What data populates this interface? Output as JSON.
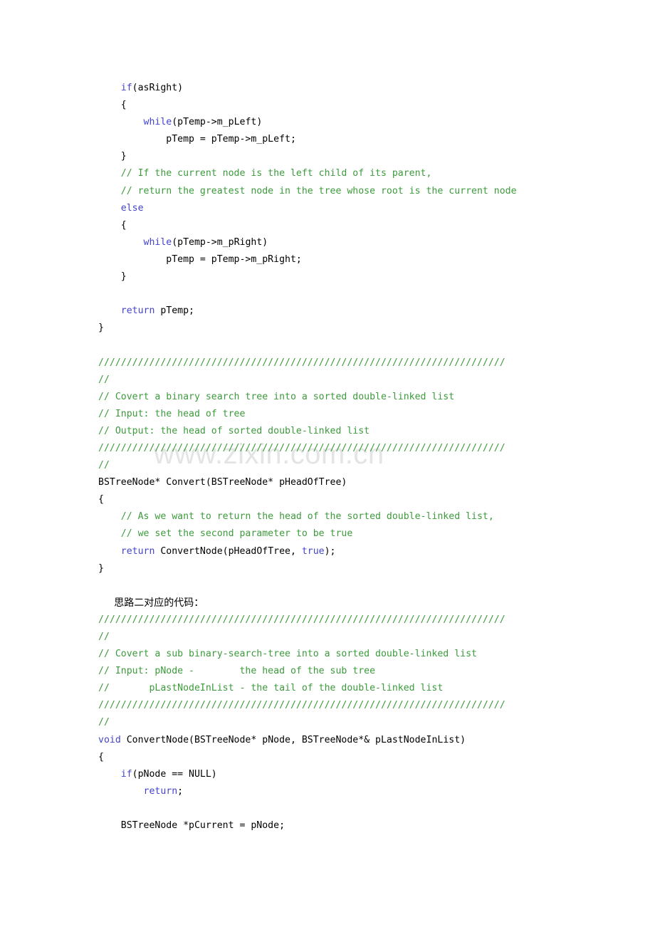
{
  "document": {
    "page_background": "#ffffff",
    "text_color": "#000000",
    "keyword_color": "#4444cc",
    "comment_color": "#3c9b3c",
    "watermark_color": "#e4e4e4"
  },
  "watermark": {
    "text": "www.zixin.com.cn"
  },
  "code": {
    "language": "cpp",
    "lines": [
      {
        "tokens": [
          {
            "t": "    ",
            "c": "pl"
          },
          {
            "t": "if",
            "c": "kw"
          },
          {
            "t": "(asRight)",
            "c": "pl"
          }
        ]
      },
      {
        "tokens": [
          {
            "t": "    {",
            "c": "pl"
          }
        ]
      },
      {
        "tokens": [
          {
            "t": "        ",
            "c": "pl"
          },
          {
            "t": "while",
            "c": "kw"
          },
          {
            "t": "(pTemp->m_pLeft)",
            "c": "pl"
          }
        ]
      },
      {
        "tokens": [
          {
            "t": "            pTemp = pTemp->m_pLeft;",
            "c": "pl"
          }
        ]
      },
      {
        "tokens": [
          {
            "t": "    }",
            "c": "pl"
          }
        ]
      },
      {
        "tokens": [
          {
            "t": "    // If the current node is the left child of its parent,",
            "c": "cm"
          }
        ]
      },
      {
        "tokens": [
          {
            "t": "    // return the greatest node in the tree whose root is the current node",
            "c": "cm"
          }
        ]
      },
      {
        "tokens": [
          {
            "t": "    ",
            "c": "pl"
          },
          {
            "t": "else",
            "c": "kw"
          }
        ]
      },
      {
        "tokens": [
          {
            "t": "    {",
            "c": "pl"
          }
        ]
      },
      {
        "tokens": [
          {
            "t": "        ",
            "c": "pl"
          },
          {
            "t": "while",
            "c": "kw"
          },
          {
            "t": "(pTemp->m_pRight)",
            "c": "pl"
          }
        ]
      },
      {
        "tokens": [
          {
            "t": "            pTemp = pTemp->m_pRight;",
            "c": "pl"
          }
        ]
      },
      {
        "tokens": [
          {
            "t": "    }",
            "c": "pl"
          }
        ]
      },
      {
        "tokens": []
      },
      {
        "tokens": [
          {
            "t": "    ",
            "c": "pl"
          },
          {
            "t": "return",
            "c": "kw"
          },
          {
            "t": " pTemp;",
            "c": "pl"
          }
        ]
      },
      {
        "tokens": [
          {
            "t": "}",
            "c": "pl"
          }
        ]
      },
      {
        "tokens": []
      },
      {
        "tokens": [
          {
            "t": "////////////////////////////////////////////////////////////////////////",
            "c": "cm"
          }
        ]
      },
      {
        "tokens": [
          {
            "t": "//",
            "c": "cm"
          }
        ]
      },
      {
        "tokens": [
          {
            "t": "// Covert a binary search tree into a sorted double-linked list",
            "c": "cm"
          }
        ]
      },
      {
        "tokens": [
          {
            "t": "// Input: the head of tree",
            "c": "cm"
          }
        ]
      },
      {
        "tokens": [
          {
            "t": "// Output: the head of sorted double-linked list",
            "c": "cm"
          }
        ]
      },
      {
        "tokens": [
          {
            "t": "////////////////////////////////////////////////////////////////////////",
            "c": "cm"
          }
        ]
      },
      {
        "tokens": [
          {
            "t": "//",
            "c": "cm"
          }
        ]
      },
      {
        "tokens": [
          {
            "t": "BSTreeNode* Convert(BSTreeNode* pHeadOfTree)",
            "c": "pl"
          }
        ]
      },
      {
        "tokens": [
          {
            "t": "{",
            "c": "pl"
          }
        ]
      },
      {
        "tokens": [
          {
            "t": "    // As we want to return the head of the sorted double-linked list,",
            "c": "cm"
          }
        ]
      },
      {
        "tokens": [
          {
            "t": "    // we set the second parameter to be true",
            "c": "cm"
          }
        ]
      },
      {
        "tokens": [
          {
            "t": "    ",
            "c": "pl"
          },
          {
            "t": "return",
            "c": "kw"
          },
          {
            "t": " ConvertNode(pHeadOfTree, ",
            "c": "pl"
          },
          {
            "t": "true",
            "c": "kw"
          },
          {
            "t": ");",
            "c": "pl"
          }
        ]
      },
      {
        "tokens": [
          {
            "t": "}",
            "c": "pl"
          }
        ]
      },
      {
        "tokens": []
      },
      {
        "tokens": [
          {
            "t": "     思路二对应的代码：",
            "c": "cjk"
          }
        ]
      },
      {
        "tokens": [
          {
            "t": "////////////////////////////////////////////////////////////////////////",
            "c": "cm"
          }
        ]
      },
      {
        "tokens": [
          {
            "t": "//",
            "c": "cm"
          }
        ]
      },
      {
        "tokens": [
          {
            "t": "// Covert a sub binary-search-tree into a sorted double-linked list",
            "c": "cm"
          }
        ]
      },
      {
        "tokens": [
          {
            "t": "// Input: pNode -        the head of the sub tree",
            "c": "cm"
          }
        ]
      },
      {
        "tokens": [
          {
            "t": "//       pLastNodeInList - the tail of the double-linked list",
            "c": "cm"
          }
        ]
      },
      {
        "tokens": [
          {
            "t": "////////////////////////////////////////////////////////////////////////",
            "c": "cm"
          }
        ]
      },
      {
        "tokens": [
          {
            "t": "//",
            "c": "cm"
          }
        ]
      },
      {
        "tokens": [
          {
            "t": "void",
            "c": "kw"
          },
          {
            "t": " ConvertNode(BSTreeNode* pNode, BSTreeNode*& pLastNodeInList)",
            "c": "pl"
          }
        ]
      },
      {
        "tokens": [
          {
            "t": "{",
            "c": "pl"
          }
        ]
      },
      {
        "tokens": [
          {
            "t": "    ",
            "c": "pl"
          },
          {
            "t": "if",
            "c": "kw"
          },
          {
            "t": "(pNode == NULL)",
            "c": "pl"
          }
        ]
      },
      {
        "tokens": [
          {
            "t": "        ",
            "c": "pl"
          },
          {
            "t": "return",
            "c": "kw"
          },
          {
            "t": ";",
            "c": "pl"
          }
        ]
      },
      {
        "tokens": []
      },
      {
        "tokens": [
          {
            "t": "    BSTreeNode *pCurrent = pNode;",
            "c": "pl"
          }
        ]
      }
    ]
  }
}
